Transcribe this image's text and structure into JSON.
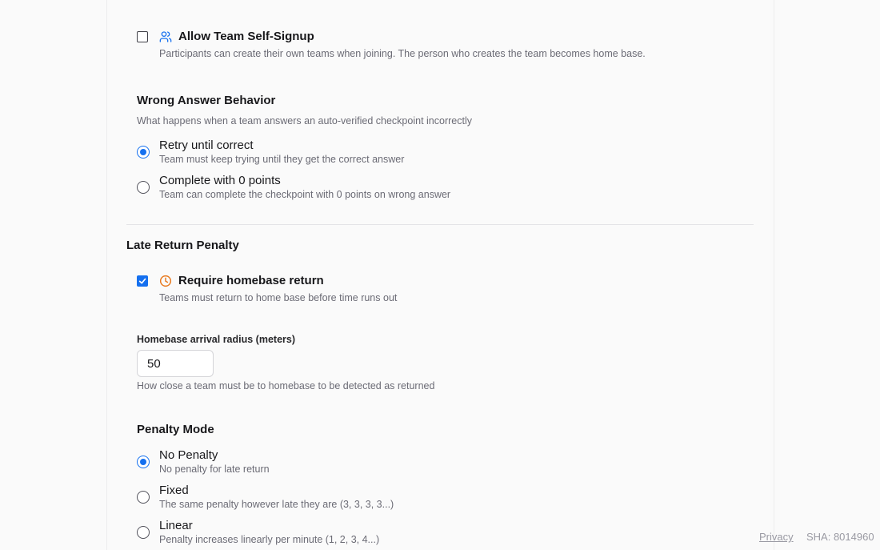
{
  "self_signup": {
    "checked": false,
    "label": "Allow Team Self-Signup",
    "description": "Participants can create their own teams when joining. The person who creates the team becomes home base.",
    "icon": "users-icon"
  },
  "wrong_answer": {
    "title": "Wrong Answer Behavior",
    "description": "What happens when a team answers an auto-verified checkpoint incorrectly",
    "options": [
      {
        "label": "Retry until correct",
        "description": "Team must keep trying until they get the correct answer",
        "selected": true
      },
      {
        "label": "Complete with 0 points",
        "description": "Team can complete the checkpoint with 0 points on wrong answer",
        "selected": false
      }
    ]
  },
  "late_return": {
    "title": "Late Return Penalty",
    "require_return": {
      "checked": true,
      "label": "Require homebase return",
      "description": "Teams must return to home base before time runs out",
      "icon": "clock-icon"
    },
    "radius": {
      "label": "Homebase arrival radius (meters)",
      "value": "50",
      "help": "How close a team must be to homebase to be detected as returned"
    },
    "penalty_mode": {
      "title": "Penalty Mode",
      "options": [
        {
          "label": "No Penalty",
          "description": "No penalty for late return",
          "selected": true
        },
        {
          "label": "Fixed",
          "description": "The same penalty however late they are (3, 3, 3, 3...)",
          "selected": false
        },
        {
          "label": "Linear",
          "description": "Penalty increases linearly per minute (1, 2, 3, 4...)",
          "selected": false
        }
      ]
    }
  },
  "footer": {
    "privacy": "Privacy",
    "sha": "SHA: 8014960"
  },
  "colors": {
    "accent": "#1570ef",
    "warning_icon": "#e8791e",
    "users_icon": "#1570ef"
  }
}
